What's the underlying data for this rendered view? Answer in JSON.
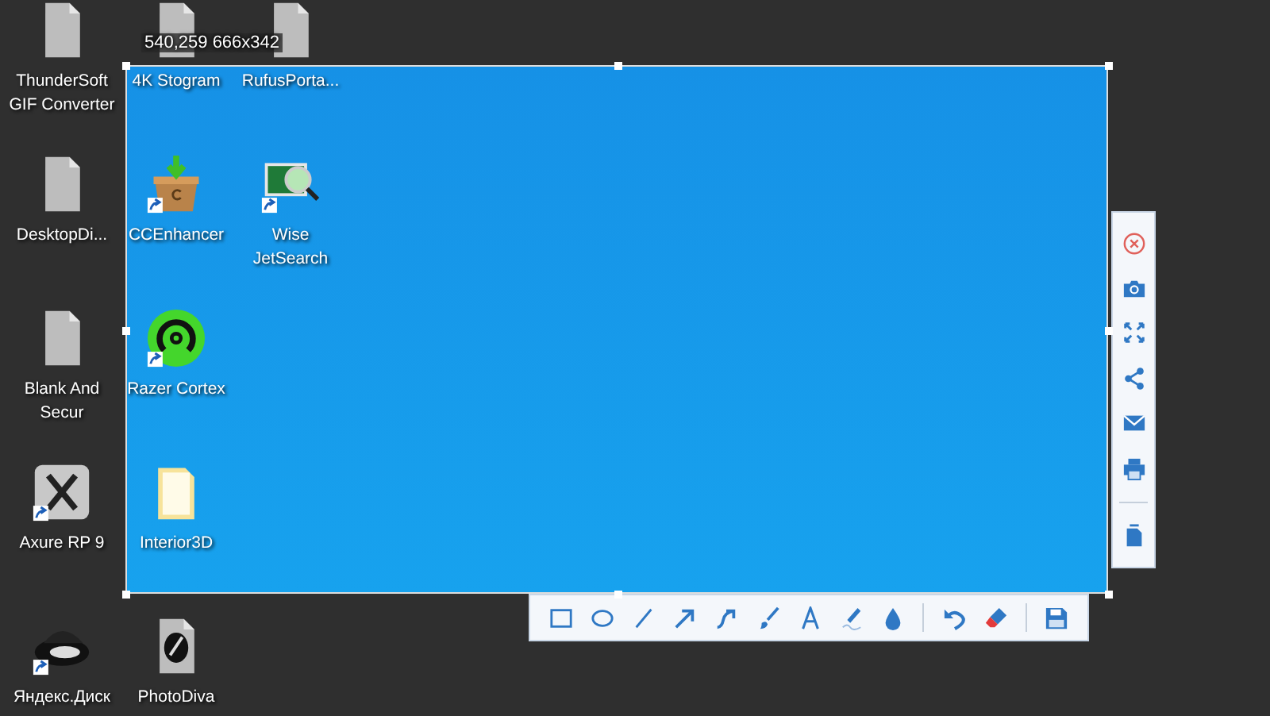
{
  "desktop_icons": [
    {
      "label": "ThunderSoft GIF Converter",
      "kind": "file",
      "shortcut": false
    },
    {
      "label": "DesktopDi...",
      "kind": "file",
      "shortcut": false
    },
    {
      "label": "Blank And Secur",
      "kind": "file",
      "shortcut": false
    },
    {
      "label": "Axure RP 9",
      "kind": "axure",
      "shortcut": true
    },
    {
      "label": "Яндекс.Диск",
      "kind": "disk",
      "shortcut": true
    },
    {
      "label": "4K Stogram",
      "kind": "file",
      "shortcut": false
    },
    {
      "label": "CCEnhancer",
      "kind": "basket",
      "shortcut": true
    },
    {
      "label": "Razer Cortex",
      "kind": "gauge",
      "shortcut": true
    },
    {
      "label": "Interior3D",
      "kind": "folder",
      "shortcut": false
    },
    {
      "label": "PhotoDiva",
      "kind": "emblem",
      "shortcut": false
    },
    {
      "label": "RufusPorta...",
      "kind": "file",
      "shortcut": false
    },
    {
      "label": "Wise JetSearch",
      "kind": "monitor",
      "shortcut": true
    }
  ],
  "selection": {
    "dimensions": "540,259 666x342"
  }
}
